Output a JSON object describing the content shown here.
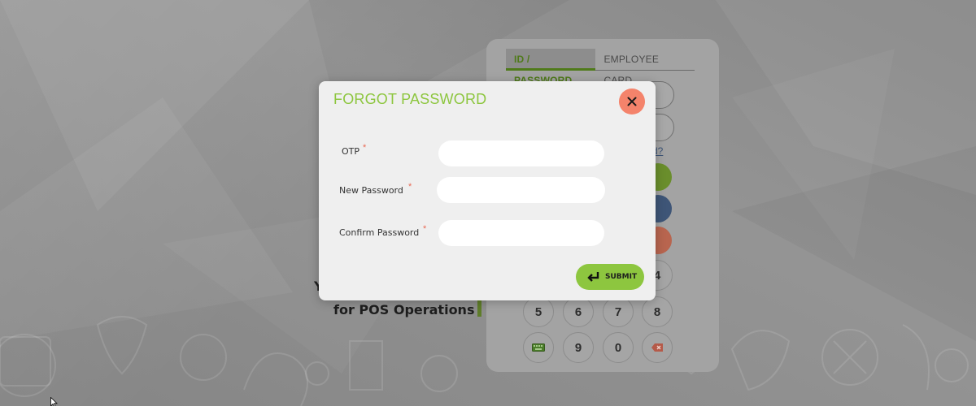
{
  "login": {
    "tabs": [
      {
        "label": "ID / PASSWORD",
        "active": true
      },
      {
        "label": "EMPLOYEE CARD",
        "active": false
      }
    ],
    "forgot_link_fragment": "rd?",
    "keypad": [
      {
        "label": "4"
      },
      {
        "label": "5"
      },
      {
        "label": "6"
      },
      {
        "label": "7"
      },
      {
        "label": "8"
      },
      {
        "label": "keyboard",
        "icon": "keyboard-icon"
      },
      {
        "label": "9"
      },
      {
        "label": "0"
      },
      {
        "label": "backspace",
        "icon": "backspace-icon"
      }
    ],
    "side_text_partial": "Y",
    "side_text": "for POS Operations"
  },
  "modal": {
    "title": "FORGOT PASSWORD",
    "close_icon": "close-icon",
    "fields": [
      {
        "label": "OTP",
        "required_mark": "*",
        "value": "",
        "placeholder": ""
      },
      {
        "label": "New Password",
        "required_mark": "*",
        "value": "",
        "placeholder": ""
      },
      {
        "label": "Confirm Password",
        "required_mark": "*",
        "value": "",
        "placeholder": ""
      }
    ],
    "submit_label": "SUBMIT",
    "submit_icon": "enter-icon"
  },
  "colors": {
    "accent": "#8dc63f",
    "close": "#f4836b",
    "required": "#e96a55",
    "login_button_green": "#6a8e2c",
    "login_button_blue": "#3e5577",
    "login_button_red": "#b8654f"
  }
}
